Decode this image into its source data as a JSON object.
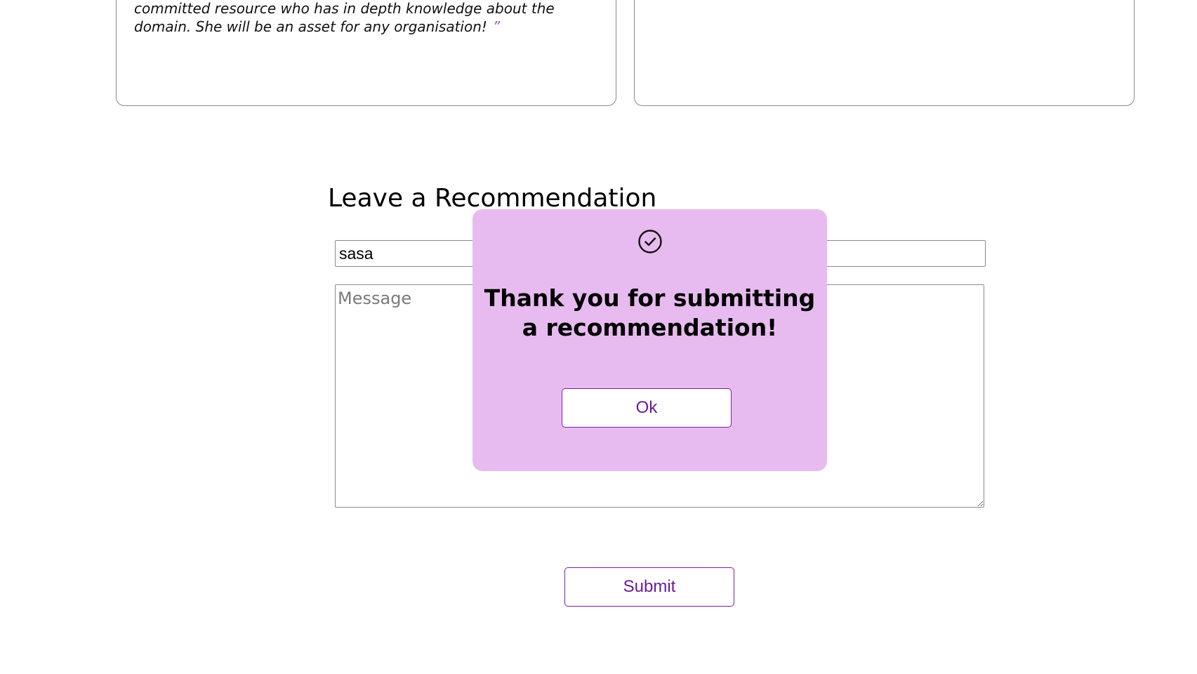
{
  "testimonials": [
    {
      "text": "committed resource who has in depth knowledge about the domain. She will be an asset for any organisation!",
      "close_quote": "”"
    },
    {
      "text": ""
    }
  ],
  "recommendation_form": {
    "title": "Leave a Recommendation",
    "name_value": "sasa",
    "message_placeholder": "Message",
    "submit_label": "Submit"
  },
  "modal": {
    "icon": "check-circle-icon",
    "message": "Thank you for submitting a recommendation!",
    "ok_label": "Ok"
  },
  "colors": {
    "modal_background": "#e8bbf0",
    "accent": "#7b1fa2"
  }
}
